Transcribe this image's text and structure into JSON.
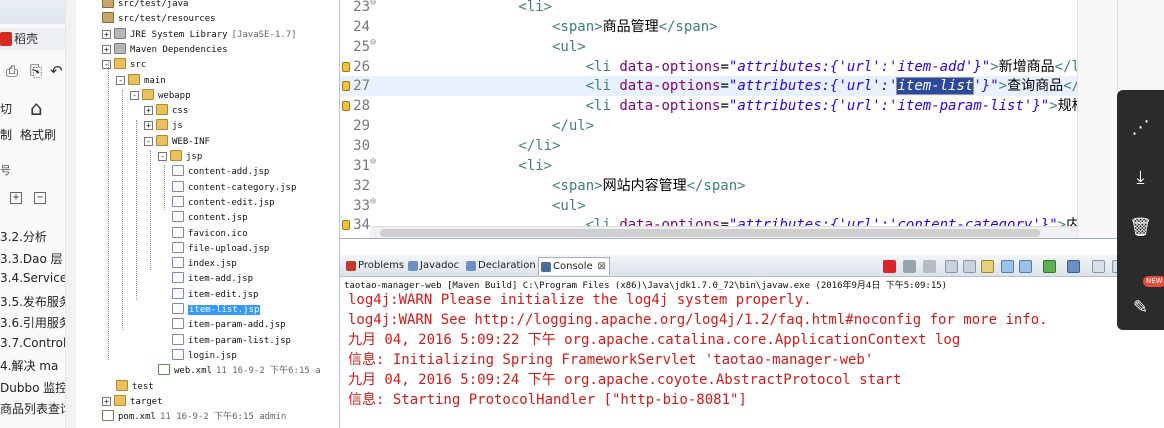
{
  "left_pane": {
    "brand": "稻壳",
    "cut_label": "切",
    "format_brush_label": "格式刷",
    "zhi_label": "制",
    "outline_items": [
      "3.2.分析",
      "3.3.Dao 层",
      "3.4.Service",
      "3.5.发布服务",
      "3.6.引用服务",
      "3.7.Control",
      "4.解决 ma",
      "Dubbo 监控",
      "商品列表查询"
    ]
  },
  "explorer": {
    "rows": [
      {
        "label": "src/test/java",
        "icon": "pkg",
        "indent": 1
      },
      {
        "label": "src/test/resources",
        "icon": "pkg",
        "indent": 1
      },
      {
        "label": "JRE System Library",
        "suffix": "[JavaSE-1.7]",
        "icon": "lib",
        "indent": 1,
        "exp": "+"
      },
      {
        "label": "Maven Dependencies",
        "icon": "lib",
        "indent": 1,
        "exp": "+"
      },
      {
        "label": "src",
        "icon": "folder",
        "indent": 1,
        "exp": "-"
      },
      {
        "label": "main",
        "icon": "folder",
        "indent": 2,
        "exp": "-"
      },
      {
        "label": "webapp",
        "icon": "folder",
        "indent": 3,
        "exp": "-"
      },
      {
        "label": "css",
        "icon": "folder",
        "indent": 4,
        "exp": "+"
      },
      {
        "label": "js",
        "icon": "folder",
        "indent": 4,
        "exp": "+"
      },
      {
        "label": "WEB-INF",
        "icon": "folder",
        "indent": 4,
        "exp": "-"
      },
      {
        "label": "jsp",
        "icon": "folder",
        "indent": 5,
        "exp": "-"
      },
      {
        "label": "content-add.jsp",
        "icon": "jsp",
        "indent": 6
      },
      {
        "label": "content-category.jsp",
        "icon": "jsp",
        "indent": 6
      },
      {
        "label": "content-edit.jsp",
        "icon": "jsp",
        "indent": 6
      },
      {
        "label": "content.jsp",
        "icon": "jsp",
        "indent": 6
      },
      {
        "label": "favicon.ico",
        "icon": "file",
        "indent": 6
      },
      {
        "label": "file-upload.jsp",
        "icon": "jsp",
        "indent": 6
      },
      {
        "label": "index.jsp",
        "icon": "jsp",
        "indent": 6
      },
      {
        "label": "item-add.jsp",
        "icon": "jsp",
        "indent": 6
      },
      {
        "label": "item-edit.jsp",
        "icon": "jsp",
        "indent": 6
      },
      {
        "label": "item-list.jsp",
        "icon": "jsp",
        "indent": 6,
        "selected": true
      },
      {
        "label": "item-param-add.jsp",
        "icon": "jsp",
        "indent": 6
      },
      {
        "label": "item-param-list.jsp",
        "icon": "jsp",
        "indent": 6
      },
      {
        "label": "login.jsp",
        "icon": "jsp",
        "indent": 6
      },
      {
        "label": "web.xml",
        "suffix": "11  16-9-2 下午6:15  a",
        "icon": "xml",
        "indent": 5
      },
      {
        "label": "test",
        "icon": "folder",
        "indent": 2
      },
      {
        "label": "target",
        "icon": "folder",
        "indent": 1,
        "exp": "+"
      },
      {
        "label": "pom.xml",
        "suffix": "11  16-9-2 下午6:15   admin",
        "icon": "xml",
        "indent": 1
      }
    ]
  },
  "editor": {
    "lines": [
      {
        "num": "23",
        "fold": "⊖",
        "html": "<span class='tag'>&lt;li&gt;</span>",
        "indent": 16
      },
      {
        "num": "24",
        "html": "<span class='tag'>&lt;span&gt;</span><span class='txt'>商品管理</span><span class='tag'>&lt;/span&gt;</span>",
        "indent": 20
      },
      {
        "num": "25",
        "fold": "⊖",
        "html": "<span class='tag'>&lt;ul&gt;</span>",
        "indent": 20
      },
      {
        "num": "26",
        "warn": true,
        "html": "<span class='tag'>&lt;li </span><span class='attr'>data-options</span><span class='txt'>=</span><span class='val'>\"attributes:{'url':'item-add'}\"</span><span class='tag'>&gt;</span><span class='txt'>新增商品</span><span class='tag'>&lt;/li&gt;</span>",
        "indent": 24
      },
      {
        "num": "27",
        "warn": true,
        "current": true,
        "html": "<span class='tag'>&lt;li </span><span class='attr'>data-options</span><span class='txt'>=</span><span class='val'>\"attributes:{'url':'</span><span class='hl'>item-list</span><span class='val'>'}\"</span><span class='tag'>&gt;</span><span class='txt'>查询商品</span><span class='tag'>&lt;/li&gt;</span>",
        "indent": 24
      },
      {
        "num": "28",
        "warn": true,
        "html": "<span class='tag'>&lt;li </span><span class='attr'>data-options</span><span class='txt'>=</span><span class='val'>\"attributes:{'url':'item-param-list'}\"</span><span class='tag'>&gt;</span><span class='txt'>规格参数</span><span class='tag'>&lt;/li&gt;</span>",
        "indent": 24
      },
      {
        "num": "29",
        "html": "<span class='tag'>&lt;/ul&gt;</span>",
        "indent": 20
      },
      {
        "num": "30",
        "html": "<span class='tag'>&lt;/li&gt;</span>",
        "indent": 16
      },
      {
        "num": "31",
        "fold": "⊖",
        "html": "<span class='tag'>&lt;li&gt;</span>",
        "indent": 16
      },
      {
        "num": "32",
        "html": "<span class='tag'>&lt;span&gt;</span><span class='txt'>网站内容管理</span><span class='tag'>&lt;/span&gt;</span>",
        "indent": 20
      },
      {
        "num": "33",
        "fold": "⊖",
        "html": "<span class='tag'>&lt;ul&gt;</span>",
        "indent": 20
      },
      {
        "num": "34",
        "warn": true,
        "html": "<span class='tag'>&lt;li </span><span class='attr'>data-options</span><span class='txt'>=</span><span class='val'>\"attributes:{'url':'content-category'}\"</span><span class='tag'>&gt;</span><span class='txt'>内容分类管理</span><span class='tag'>&lt;/li&gt;</span>",
        "indent": 24
      }
    ]
  },
  "console": {
    "tabs": [
      {
        "label": "Problems",
        "color": "#c0392b"
      },
      {
        "label": "Javadoc",
        "color": "#6b8fc7"
      },
      {
        "label": "Declaration",
        "color": "#6b8fc7"
      },
      {
        "label": "Console",
        "color": "#4a6e96",
        "active": true
      }
    ],
    "header": "taotao-manager-web [Maven Build] C:\\Program Files (x86)\\Java\\jdk1.7.0_72\\bin\\javaw.exe (2016年9月4日 下午5:09:15)",
    "lines": [
      "log4j:WARN Please initialize the log4j system properly.",
      "log4j:WARN See http://logging.apache.org/log4j/1.2/faq.html#noconfig for more info.",
      "九月 04, 2016 5:09:22 下午 org.apache.catalina.core.ApplicationContext log",
      "信息: Initializing Spring FrameworkServlet 'taotao-manager-web'",
      "九月 04, 2016 5:09:24 下午 org.apache.coyote.AbstractProtocol start",
      "信息: Starting ProtocolHandler [\"http-bio-8081\"]"
    ]
  },
  "float_bar": {
    "new_badge": "NEW"
  }
}
